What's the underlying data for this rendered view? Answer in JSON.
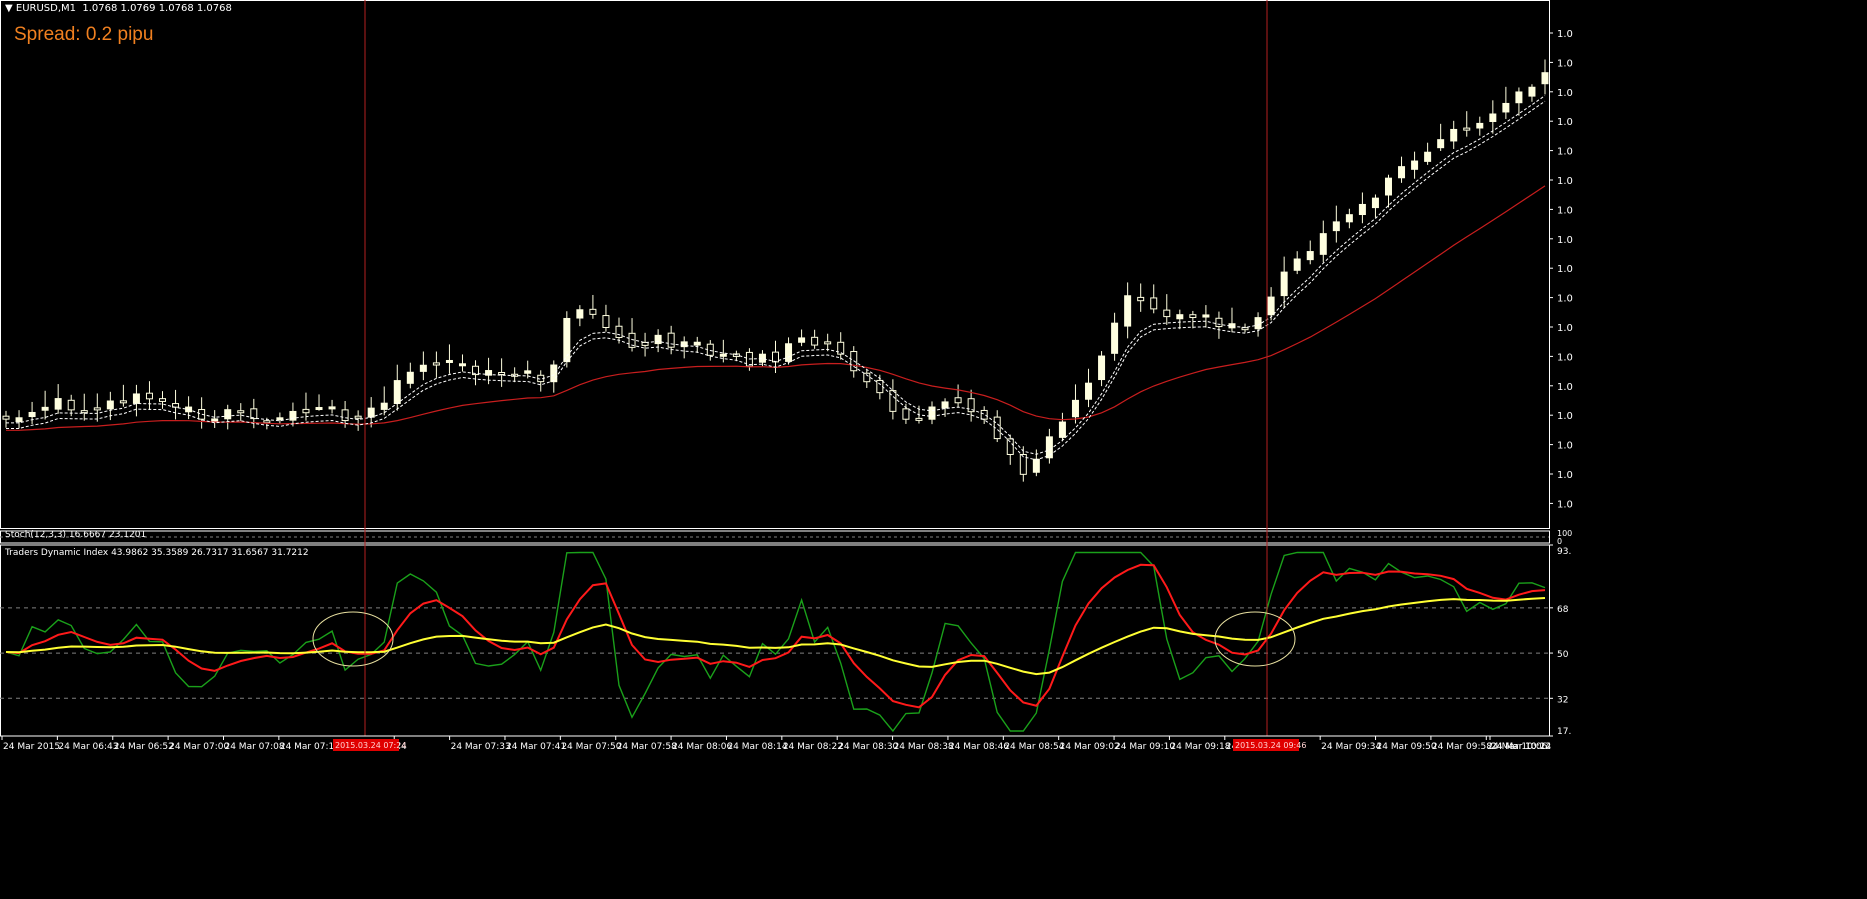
{
  "header": {
    "symbol_line": "EURUSD,M1  1.0768 1.0769 1.0768 1.0768",
    "spread": "Spread: 0.2 pipu",
    "stoch_line": "Stoch(12,3,3) 16.6667 23.1201",
    "tdi_line": "Traders Dynamic Index 43.9862 35.3589 26.7317 31.6567 31.7212"
  },
  "price_axis_labels": [
    "1.0",
    "1.0",
    "1.0",
    "1.0",
    "1.0",
    "1.0",
    "1.0",
    "1.0",
    "1.0",
    "1.0",
    "1.0",
    "1.0",
    "1.0",
    "1.0",
    "1.0",
    "1.0",
    "1.0"
  ],
  "stoch_axis_labels": [
    "100",
    "0"
  ],
  "tdi_axis_labels": [
    "93.",
    "68",
    "50",
    "32",
    "17."
  ],
  "time_labels": [
    "24 Mar 2015",
    "24 Mar 06:43",
    "24 Mar 06:52",
    "24 Mar 07:00",
    "24 Mar 07:08",
    "24 Mar 07:16",
    "24",
    "24 Mar 07:33",
    "24 Mar 07:41",
    "24 Mar 07:50",
    "24 Mar 07:58",
    "24 Mar 08:06",
    "24 Mar 08:14",
    "24 Mar 08:22",
    "24 Mar 08:30",
    "24 Mar 08:38",
    "24 Mar 08:46",
    "24 Mar 08:54",
    "24 Mar 09:02",
    "24 Mar 09:10",
    "24 Mar 09:18",
    "24 Mar 09:26",
    "24 Mar 09:34",
    "24 Mar 09:50",
    "24 Mar 09:58",
    "24 Mar 10:06",
    "24 Mar 10:14",
    "24 Mar 10:22"
  ],
  "cursor_time_labels": [
    "2015.03.24 07:24",
    "2015.03.24 09:46"
  ],
  "colors": {
    "background": "#000000",
    "candle": "#ffffe0",
    "slow_ma": "#c81e1e",
    "fast_ma": "#ffffff",
    "grid": "#808080",
    "cursor_line": "#b42020",
    "tdi_green": "#1aa01a",
    "tdi_red": "#ff1a1a",
    "tdi_yellow": "#ffff33",
    "spread_text": "#f08020"
  },
  "chart_data": {
    "type": "candlestick",
    "symbol": "EURUSD",
    "timeframe": "M1",
    "price_series_profile": [
      0,
      0,
      1,
      1,
      2,
      1,
      1,
      1,
      2,
      2,
      3,
      2,
      2,
      1,
      1,
      0,
      0,
      1,
      1,
      0,
      0,
      0,
      1,
      1,
      1,
      1,
      0,
      0,
      1,
      2,
      4,
      5,
      6,
      6,
      6,
      6,
      5,
      5,
      5,
      5,
      5,
      4,
      6,
      11,
      12,
      11,
      10,
      9,
      8,
      8,
      9,
      8,
      8,
      8,
      7,
      7,
      7,
      6,
      7,
      6,
      8,
      9,
      8,
      8,
      7,
      5,
      4,
      3,
      1,
      0,
      0,
      1,
      2,
      2,
      1,
      0,
      -2,
      -4,
      -6,
      -4,
      -2,
      0,
      2,
      4,
      7,
      10,
      13,
      13,
      12,
      11,
      11,
      11,
      11,
      10,
      10,
      10,
      11,
      13,
      16,
      17,
      18,
      20,
      21,
      22,
      23,
      24,
      26,
      27,
      28,
      29,
      30,
      31,
      31,
      32,
      33,
      34,
      35,
      36,
      37
    ],
    "indicators": [
      {
        "name": "Stoch(12,3,3)",
        "values": [
          16.6667,
          23.1201
        ]
      },
      {
        "name": "Traders Dynamic Index",
        "values": [
          43.9862,
          35.3589,
          26.7317,
          31.6567,
          31.7212
        ],
        "levels": [
          68,
          50,
          32
        ]
      }
    ]
  }
}
